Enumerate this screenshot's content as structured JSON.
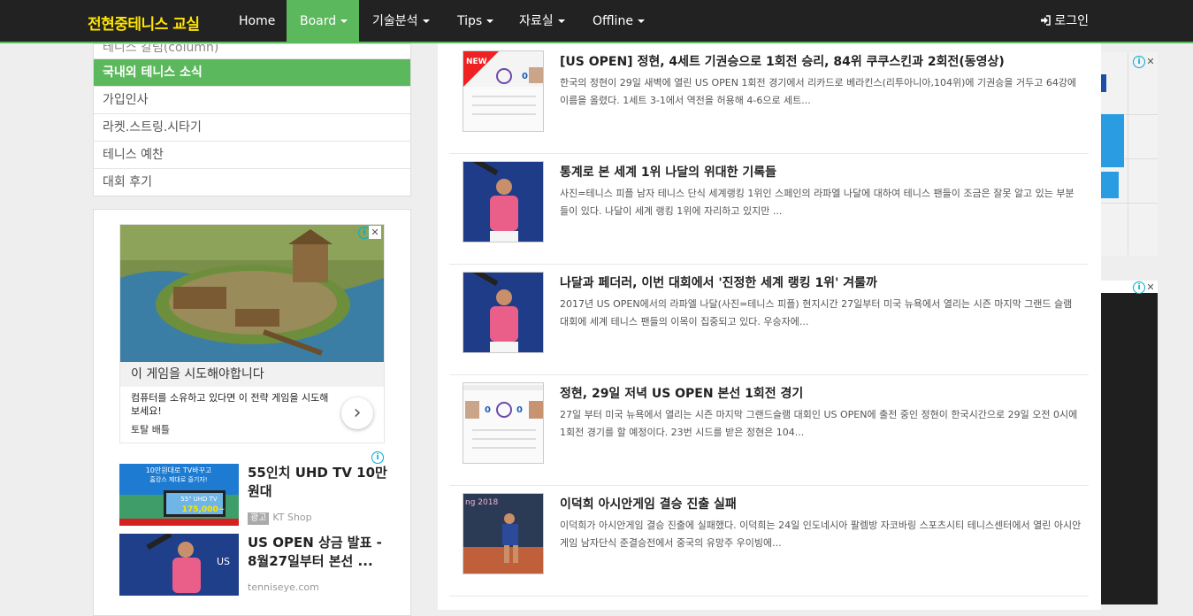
{
  "nav": {
    "brand": "전현중테니스 교실",
    "items": [
      {
        "label": "Home",
        "dropdown": false
      },
      {
        "label": "Board",
        "dropdown": true
      },
      {
        "label": "기술분석",
        "dropdown": true
      },
      {
        "label": "Tips",
        "dropdown": true
      },
      {
        "label": "자료실",
        "dropdown": true
      },
      {
        "label": "Offline",
        "dropdown": true
      }
    ],
    "login": "로그인",
    "accent": "#5cb85c",
    "brand_color": "#ffe400"
  },
  "sidebar": {
    "categories": [
      {
        "label": "테니스 칼럼(column)"
      },
      {
        "label": "국내외 테니스 소식"
      },
      {
        "label": "가입인사"
      },
      {
        "label": "라켓.스트링.시타기"
      },
      {
        "label": "테니스 예찬"
      },
      {
        "label": "대회 후기"
      }
    ],
    "ad": {
      "title": "이 게임을 시도해야합니다",
      "description": "컴퓨터를 소유하고 있다면 이 전략 게임을 시도해보세요!",
      "sponsor": "토탈 배틀"
    },
    "recommendations": [
      {
        "title": "55인치 UHD TV 10만원대",
        "badge": "광고",
        "source": "KT Shop",
        "image_text": [
          "10만원대로 TV바꾸고",
          "홈캉스 제대로 즐기자!",
          "55\" UHD TV",
          "175,000~"
        ]
      },
      {
        "title": "US OPEN 상금 발표 - 8월27일부터 본선 ...",
        "badge": "",
        "source": "tenniseye.com",
        "image_text": []
      }
    ]
  },
  "posts": [
    {
      "title": "[US OPEN] 정현, 4세트 기권승으로 1회전 승리, 84위 쿠쿠스킨과 2회전(동영상)",
      "excerpt": "한국의 정현이 29일 새벽에 열린 US OPEN 1회전 경기에서 리카드로 베라킨스(리투아니아,104위)에 기권승을 거두고 64강에 이름을 올렸다. 1세트 3-1에서 역전을 허용해 4-6으로 세트...",
      "badge": "NEW",
      "thumb": "scoreboard"
    },
    {
      "title": "통계로 본 세계 1위 나달의 위대한 기록들",
      "excerpt": "사진=테니스 피플 남자 테니스 단식 세계랭킹 1위인 스페인의 라파엘 나달에 대하여 테니스 팬들이 조금은 잘못 알고 있는 부분들이 있다. 나달이 세계 랭킹 1위에 자리하고 있지만 ...",
      "badge": "",
      "thumb": "player"
    },
    {
      "title": "나달과 페더러, 이번 대회에서 '진정한 세계 랭킹 1위' 겨룰까",
      "excerpt": "2017년 US OPEN에서의 라파엘 나달(사진=테니스 피플) 현지시간 27일부터 미국 뉴욕에서 열리는 시즌 마지막 그랜드 슬램 대회에 세계 테니스 팬들의 이목이 집중되고 있다. 우승자에...",
      "badge": "",
      "thumb": "player"
    },
    {
      "title": "정현, 29일 저녁 US OPEN 본선 1회전 경기",
      "excerpt": "27일 부터 미국 뉴욕에서 열리는 시즌 마지막 그랜드슬램 대회인 US OPEN에 출전 중인 정현이 한국시간으로 29일 오전 0시에 1회전 경기를 할 예정이다. 23번 시드를 받은 정현은 104...",
      "badge": "",
      "thumb": "scoreboard"
    },
    {
      "title": "이덕희 아시안게임 결승 진출 실패",
      "excerpt": "이덕희가 아시안게임 결승 진출에 실패했다. 이덕희는 24일 인도네시아 팔렘방 자코바링 스포츠시티 테니스센터에서 열린 아시안게임 남자단식 준결승전에서 중국의 유망주 우이빙에...",
      "badge": "",
      "thumb": "court"
    }
  ]
}
